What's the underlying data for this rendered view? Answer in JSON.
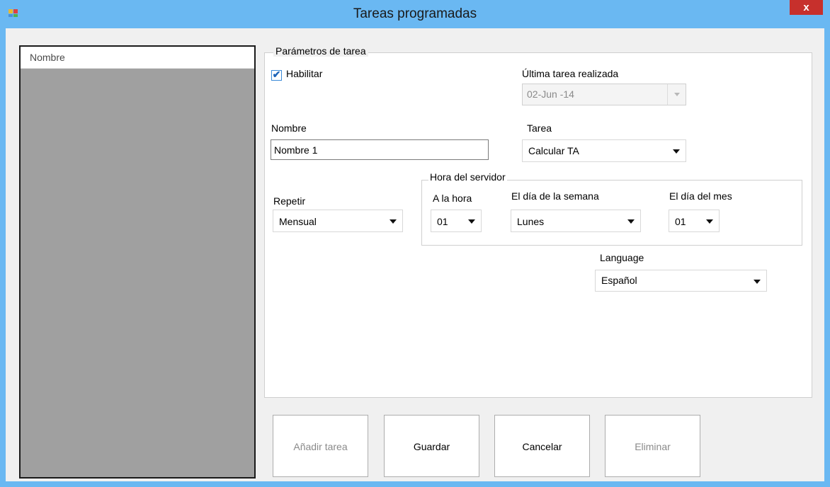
{
  "window": {
    "title": "Tareas programadas",
    "close_label": "x"
  },
  "list": {
    "header": "Nombre"
  },
  "params": {
    "legend": "Parámetros de tarea",
    "enable_label": "Habilitar",
    "enable_checked": true,
    "last_task_label": "Última tarea realizada",
    "last_task_value": "02-Jun -14",
    "name_label": "Nombre",
    "name_value": "Nombre 1",
    "task_label": "Tarea",
    "task_value": "Calcular TA",
    "repeat_label": "Repetir",
    "repeat_value": "Mensual",
    "server_time": {
      "legend": "Hora del servidor",
      "hour_label": "A la hora",
      "hour_value": "01",
      "weekday_label": "El día de la semana",
      "weekday_value": "Lunes",
      "monthday_label": "El día del mes",
      "monthday_value": "01"
    },
    "language_label": "Language",
    "language_value": "Español"
  },
  "buttons": {
    "add": "Añadir tarea",
    "save": "Guardar",
    "cancel": "Cancelar",
    "delete": "Eliminar"
  },
  "icons": {
    "app": "window-app-icon",
    "close": "close-icon",
    "check": "check-icon",
    "dropdown": "chevron-down-icon"
  },
  "colors": {
    "titlebar": "#6ab8f2",
    "close": "#c7302c",
    "list_bg": "#a0a0a0",
    "client_bg": "#f0f0f0"
  }
}
